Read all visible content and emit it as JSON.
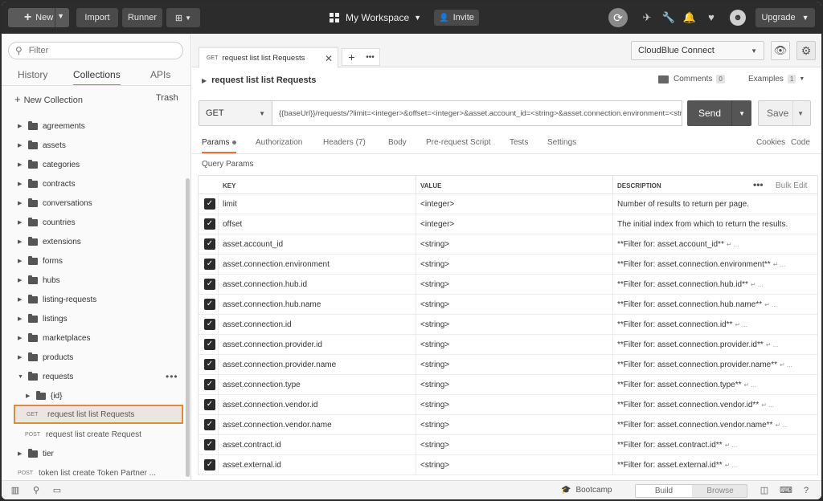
{
  "topbar": {
    "new_label": "New",
    "import_label": "Import",
    "runner_label": "Runner",
    "workspace_label": "My Workspace",
    "invite_label": "Invite",
    "upgrade_label": "Upgrade"
  },
  "sidebar": {
    "filter_placeholder": "Filter",
    "tabs": [
      {
        "label": "History"
      },
      {
        "label": "Collections",
        "active": true
      },
      {
        "label": "APIs"
      }
    ],
    "new_collection_label": "New Collection",
    "trash_label": "Trash",
    "folders": [
      {
        "name": "agreements"
      },
      {
        "name": "assets"
      },
      {
        "name": "categories"
      },
      {
        "name": "contracts"
      },
      {
        "name": "conversations"
      },
      {
        "name": "countries"
      },
      {
        "name": "extensions"
      },
      {
        "name": "forms"
      },
      {
        "name": "hubs"
      },
      {
        "name": "listing-requests"
      },
      {
        "name": "listings"
      },
      {
        "name": "marketplaces"
      },
      {
        "name": "products"
      },
      {
        "name": "requests",
        "expanded": true
      }
    ],
    "subfolder": {
      "name": "{id}"
    },
    "requests": [
      {
        "method": "GET",
        "name": "request list list Requests",
        "selected": true
      },
      {
        "method": "POST",
        "name": "request list create Request"
      }
    ],
    "tier_folder": {
      "name": "tier"
    },
    "token_request": {
      "method": "POST",
      "name": "token list create Token Partner ..."
    }
  },
  "main": {
    "tab": {
      "method": "GET",
      "name": "request list list Requests"
    },
    "environment": "CloudBlue Connect",
    "request_title": "request list list Requests",
    "comments_label": "Comments",
    "comments_count": "0",
    "examples_label": "Examples",
    "examples_count": "1",
    "method": "GET",
    "url": "{{baseUrl}}/requests/?limit=<integer>&offset=<integer>&asset.account_id=<string>&asset.connection.environment=<string>",
    "send_label": "Send",
    "save_label": "Save",
    "subtabs": [
      {
        "label": "Params",
        "active": true
      },
      {
        "label": "Authorization"
      },
      {
        "label": "Headers (7)"
      },
      {
        "label": "Body"
      },
      {
        "label": "Pre-request Script"
      },
      {
        "label": "Tests"
      },
      {
        "label": "Settings"
      }
    ],
    "cookies_label": "Cookies",
    "code_label": "Code",
    "query_params_label": "Query Params",
    "table": {
      "headers": {
        "key": "KEY",
        "value": "VALUE",
        "description": "DESCRIPTION"
      },
      "bulk_edit_label": "Bulk Edit",
      "rows": [
        {
          "key": "limit",
          "value": "<integer>",
          "description": "Number of results to return per page.",
          "more": ""
        },
        {
          "key": "offset",
          "value": "<integer>",
          "description": "The initial index from which to return the results.",
          "more": ""
        },
        {
          "key": "asset.account_id",
          "value": "<string>",
          "description": "**Filter for: asset.account_id**",
          "more": "↵ ..."
        },
        {
          "key": "asset.connection.environment",
          "value": "<string>",
          "description": "**Filter for: asset.connection.environment**",
          "more": "↵ ..."
        },
        {
          "key": "asset.connection.hub.id",
          "value": "<string>",
          "description": "**Filter for: asset.connection.hub.id**",
          "more": "↵ ..."
        },
        {
          "key": "asset.connection.hub.name",
          "value": "<string>",
          "description": "**Filter for: asset.connection.hub.name**",
          "more": "↵ ..."
        },
        {
          "key": "asset.connection.id",
          "value": "<string>",
          "description": "**Filter for: asset.connection.id**",
          "more": "↵ ..."
        },
        {
          "key": "asset.connection.provider.id",
          "value": "<string>",
          "description": "**Filter for: asset.connection.provider.id**",
          "more": "↵ ..."
        },
        {
          "key": "asset.connection.provider.name",
          "value": "<string>",
          "description": "**Filter for: asset.connection.provider.name**",
          "more": "↵ ..."
        },
        {
          "key": "asset.connection.type",
          "value": "<string>",
          "description": "**Filter for: asset.connection.type**",
          "more": "↵ ..."
        },
        {
          "key": "asset.connection.vendor.id",
          "value": "<string>",
          "description": "**Filter for: asset.connection.vendor.id**",
          "more": "↵ ..."
        },
        {
          "key": "asset.connection.vendor.name",
          "value": "<string>",
          "description": "**Filter for: asset.connection.vendor.name**",
          "more": "↵ ..."
        },
        {
          "key": "asset.contract.id",
          "value": "<string>",
          "description": "**Filter for: asset.contract.id**",
          "more": "↵ ..."
        },
        {
          "key": "asset.external.id",
          "value": "<string>",
          "description": "**Filter for: asset.external.id**",
          "more": "↵ ..."
        }
      ]
    }
  },
  "statusbar": {
    "bootcamp_label": "Bootcamp",
    "build_label": "Build",
    "browse_label": "Browse"
  }
}
